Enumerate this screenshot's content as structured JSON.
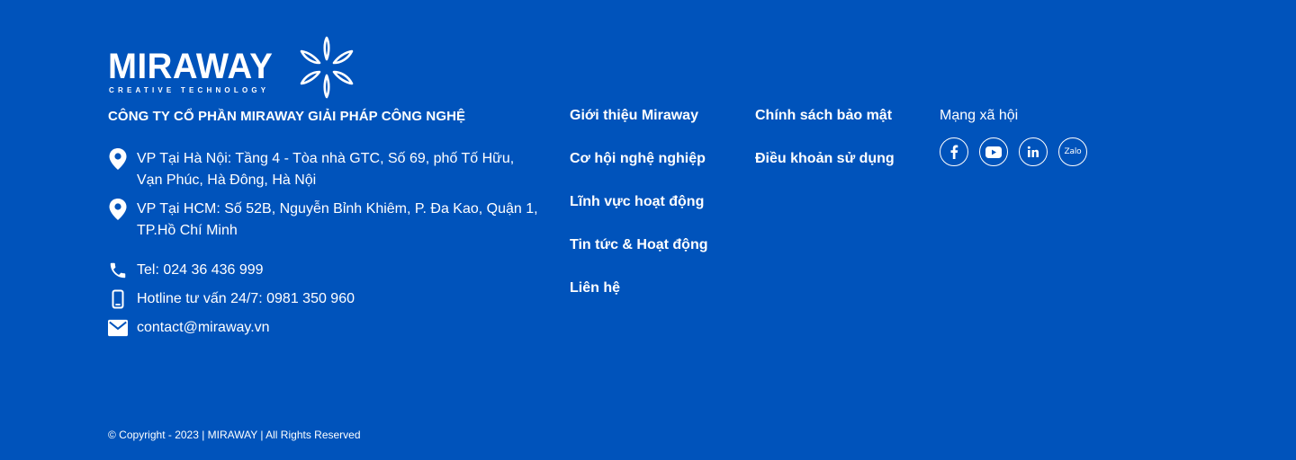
{
  "brand": {
    "name": "MIRAWAY",
    "tagline": "CREATIVE TECHNOLOGY",
    "company_name": "CÔNG TY CỔ PHẦN MIRAWAY GIẢI PHÁP CÔNG NGHỆ"
  },
  "contacts": {
    "hanoi_office": "VP Tại Hà Nội: Tầng 4 - Tòa nhà GTC, Số 69, phố Tố Hữu, Vạn Phúc, Hà Đông, Hà Nội",
    "hcm_office": "VP Tại HCM: Số 52B, Nguyễn Bỉnh Khiêm, P. Đa Kao, Quận 1, TP.Hồ Chí Minh",
    "phone": "Tel: 024 36 436 999",
    "hotline": "Hotline tư vấn 24/7: 0981 350 960",
    "email": "contact@miraway.vn"
  },
  "nav_primary": [
    {
      "label": "Giới thiệu Miraway"
    },
    {
      "label": "Cơ hội nghệ nghiệp"
    },
    {
      "label": "Lĩnh vực hoạt động"
    },
    {
      "label": "Tin tức & Hoạt động"
    },
    {
      "label": "Liên hệ"
    }
  ],
  "nav_secondary": [
    {
      "label": "Chính sách bảo mật"
    },
    {
      "label": "Điều khoản sử dụng"
    }
  ],
  "social": {
    "title": "Mạng xã hội",
    "items": [
      {
        "icon": "facebook-icon"
      },
      {
        "icon": "youtube-icon"
      },
      {
        "icon": "linkedin-icon"
      },
      {
        "icon": "zalo-icon",
        "label": "Zalo"
      }
    ]
  },
  "footer": {
    "copyright": "© Copyright - 2023 | MIRAWAY | All Rights Reserved"
  },
  "colors": {
    "background": "#0053bb",
    "text": "#ffffff"
  }
}
